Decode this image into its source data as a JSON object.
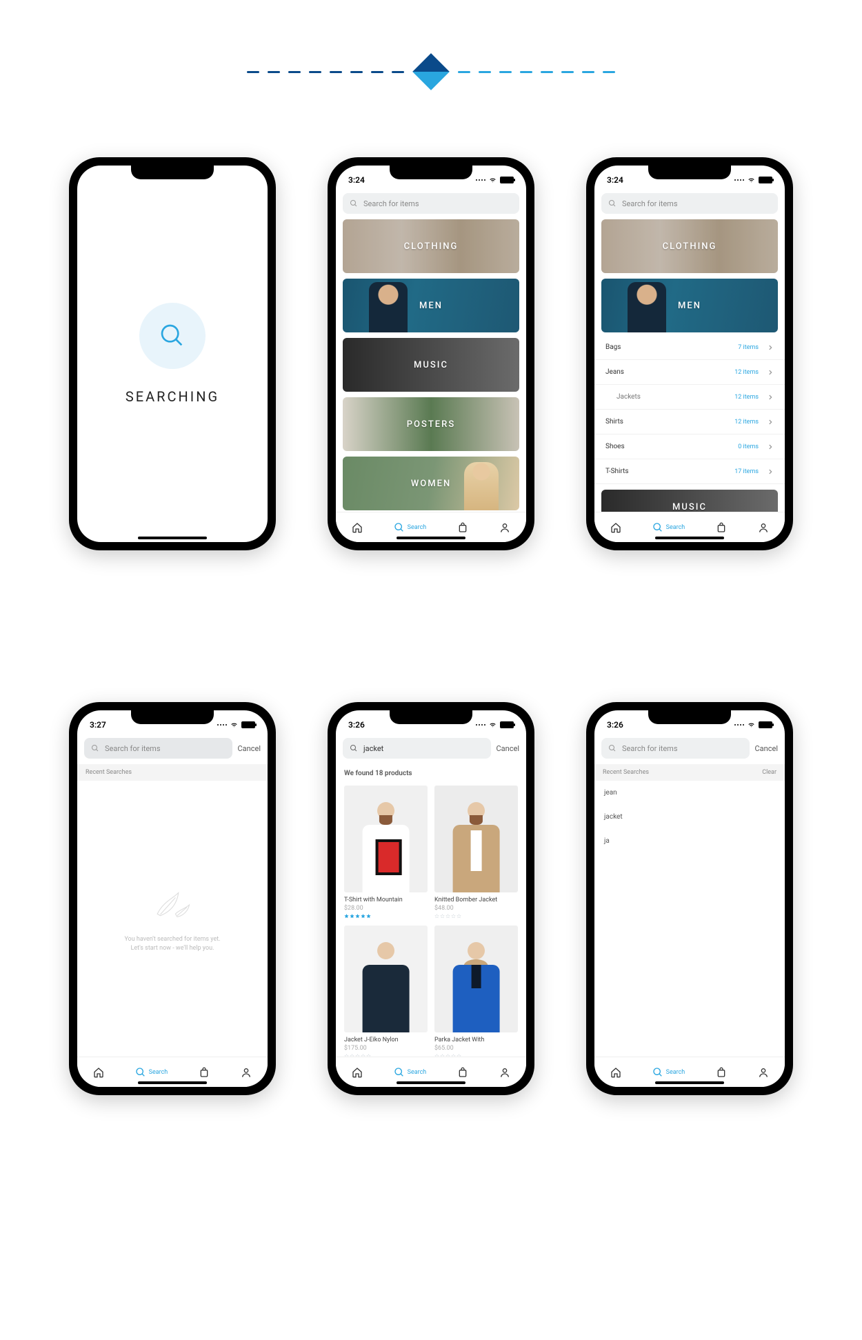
{
  "status": {
    "time_a": "3:24",
    "time_b": "3:27",
    "time_c": "3:26"
  },
  "search": {
    "placeholder": "Search for items",
    "cancel": "Cancel",
    "active_label": "Search",
    "query_jacket": "jacket"
  },
  "splash": {
    "title": "SEARCHING"
  },
  "categories": [
    {
      "label": "CLOTHING"
    },
    {
      "label": "MEN"
    },
    {
      "label": "MUSIC"
    },
    {
      "label": "POSTERS"
    },
    {
      "label": "WOMEN"
    }
  ],
  "men_subcats": [
    {
      "name": "Bags",
      "count": "7 items",
      "indent": false
    },
    {
      "name": "Jeans",
      "count": "12 items",
      "indent": false
    },
    {
      "name": "Jackets",
      "count": "12 items",
      "indent": true
    },
    {
      "name": "Shirts",
      "count": "12 items",
      "indent": false
    },
    {
      "name": "Shoes",
      "count": "0 items",
      "indent": false
    },
    {
      "name": "T-Shirts",
      "count": "17 items",
      "indent": false
    }
  ],
  "empty": {
    "line1": "You haven't searched for items yet.",
    "line2": "Let's start now - we'll help you."
  },
  "recent_header": "Recent Searches",
  "clear": "Clear",
  "found_header": "We found 18 products",
  "products": [
    {
      "name": "T-Shirt with Mountain",
      "price": "$28.00",
      "stars": 5
    },
    {
      "name": "Knitted Bomber Jacket",
      "price": "$48.00",
      "stars": 0
    },
    {
      "name": "Jacket J-Eiko Nylon",
      "price": "$175.00",
      "stars": 0
    },
    {
      "name": "Parka Jacket With",
      "price": "$65.00",
      "stars": 0
    }
  ],
  "recent_searches": [
    "jean",
    "jacket",
    "ja"
  ],
  "colors": {
    "accent": "#2aa6e0",
    "star_filled": "#2aa6e0",
    "star_empty": "#cfd6da"
  }
}
